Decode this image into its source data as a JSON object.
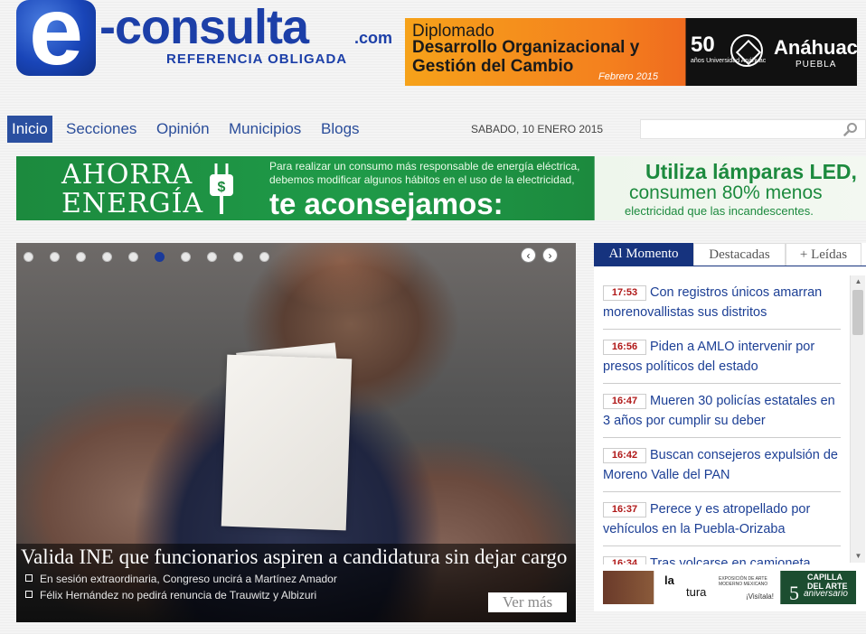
{
  "header": {
    "logo": {
      "e": "e",
      "word": "-consulta",
      "com": ".com",
      "tagline": "REFERENCIA OBLIGADA"
    },
    "ad": {
      "line1": "Diplomado",
      "line2": "Desarrollo Organizacional y",
      "line3": "Gestión del Cambio",
      "date": "Febrero 2015",
      "fifty": "50",
      "fifty_sub": "años Universidad Anáhuac",
      "brand": "Anáhuac",
      "brand_sub": "PUEBLA",
      "colors": {
        "orange": "#f4801e",
        "black": "#111111"
      }
    }
  },
  "nav": {
    "items": [
      "Inicio",
      "Secciones",
      "Opinión",
      "Municipios",
      "Blogs"
    ],
    "active_index": 0,
    "date": "SABADO, 10 ENERO 2015",
    "search": {
      "placeholder": "",
      "value": ""
    },
    "colors": {
      "link": "#2a4d9a",
      "active_bg": "#2a4fa0"
    }
  },
  "banner": {
    "t1": "AHORRA",
    "t2": "ENERGÍA",
    "small": "Para realizar un consumo más responsable de energía eléctrica, debemos modificar algunos hábitos en el uso de la electricidad,",
    "big": "te aconsejamos:",
    "r1": "Utiliza lámparas LED,",
    "r2": "consumen 80% menos",
    "r3": "electricidad que las incandescentes.",
    "colors": {
      "green": "#1c8a3e"
    }
  },
  "slider": {
    "dots_count": 10,
    "active_dot": 5,
    "prev_icon": "‹",
    "next_icon": "›",
    "title": "Valida INE que funcionarios aspiren a candidatura sin dejar cargo",
    "subs": [
      "En sesión extraordinaria, Congreso uncirá a Martínez Amador",
      "Félix Hernández no pedirá renuncia de Trauwitz y Albizuri"
    ],
    "more": "Ver más"
  },
  "sidebar": {
    "tabs": [
      "Al Momento",
      "Destacadas",
      "+ Leídas"
    ],
    "active_tab": 0,
    "news": [
      {
        "time": "17:53",
        "text": "Con registros únicos amarran morenovallistas sus distritos"
      },
      {
        "time": "16:56",
        "text": "Piden a AMLO intervenir por presos políticos del estado"
      },
      {
        "time": "16:47",
        "text": "Mueren 30 policías estatales en 3 años por cumplir su deber"
      },
      {
        "time": "16:42",
        "text": "Buscan consejeros expulsión de Moreno Valle del PAN"
      },
      {
        "time": "16:37",
        "text": "Perece y es atropellado por vehículos en la Puebla-Orizaba"
      },
      {
        "time": "16:34",
        "text": "Tras volcarse en camioneta"
      }
    ],
    "scroll_up": "▲",
    "scroll_down": "▼",
    "ad": {
      "la": "la",
      "tura": "tura",
      "info": "EXPOSICIÓN DE ARTE MODERNO MEXICANO",
      "vis": "¡Visítala!",
      "capilla": "CAPILLA DEL ARTE",
      "five": "5",
      "aniv": "aniversario"
    },
    "colors": {
      "tab_active": "#16337e",
      "time": "#b01818",
      "link": "#1c3f95"
    }
  }
}
